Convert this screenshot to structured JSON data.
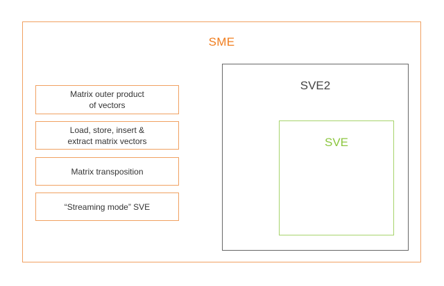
{
  "sme": {
    "title": "SME"
  },
  "features": [
    {
      "label": "Matrix outer product\nof vectors"
    },
    {
      "label": "Load, store, insert &\nextract matrix vectors"
    },
    {
      "label": "Matrix transposition"
    },
    {
      "label": "“Streaming mode” SVE"
    }
  ],
  "sve2": {
    "title": "SVE2"
  },
  "sve": {
    "title": "SVE"
  },
  "colors": {
    "sme": "#f07d1e",
    "sve2": "#666666",
    "sve": "#8cc63f"
  }
}
